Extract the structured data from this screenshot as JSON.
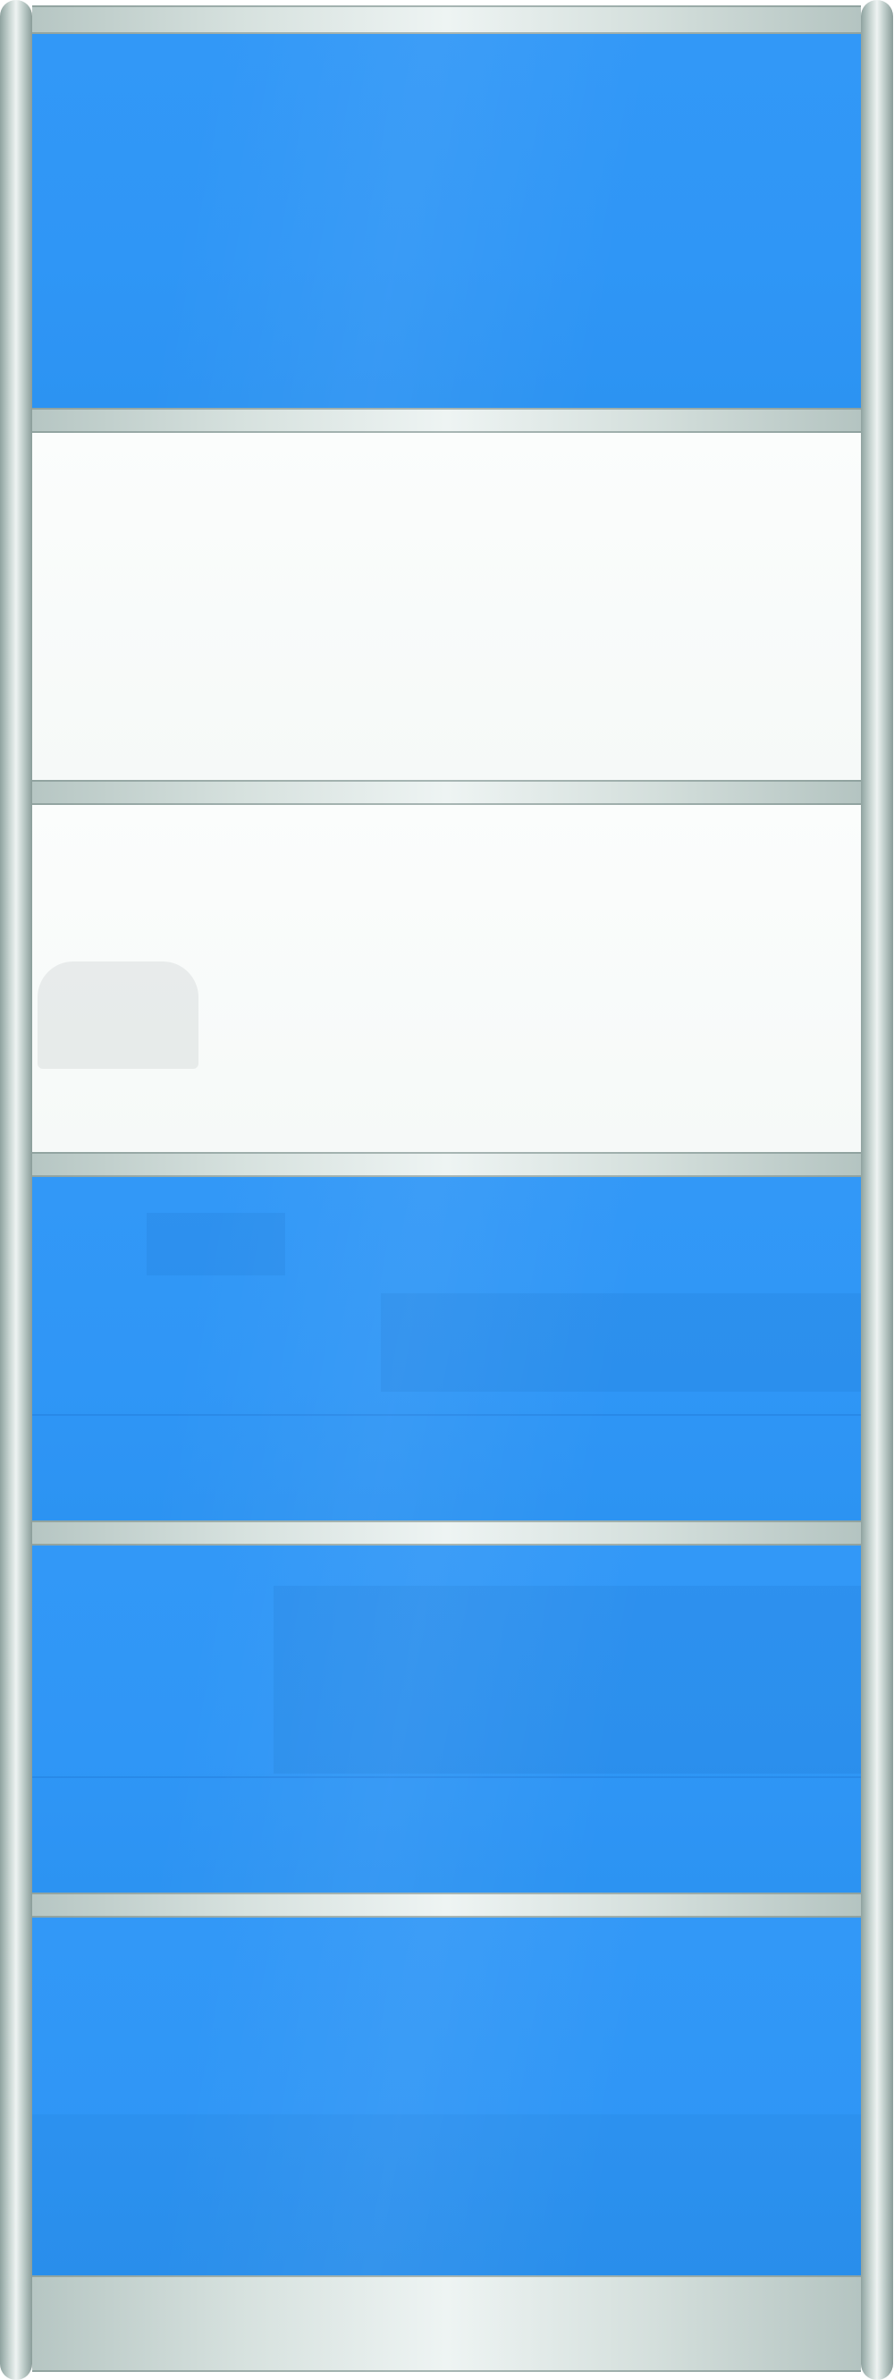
{
  "door": {
    "panels": [
      {
        "color": "blue",
        "hex": "#3298f7"
      },
      {
        "color": "white",
        "hex": "#f8fbfa"
      },
      {
        "color": "white",
        "hex": "#f8fbfa"
      },
      {
        "color": "blue",
        "hex": "#3298f7"
      },
      {
        "color": "blue",
        "hex": "#3298f7"
      },
      {
        "color": "blue",
        "hex": "#3298f7"
      }
    ],
    "frame_color": "#c9d6d3"
  }
}
